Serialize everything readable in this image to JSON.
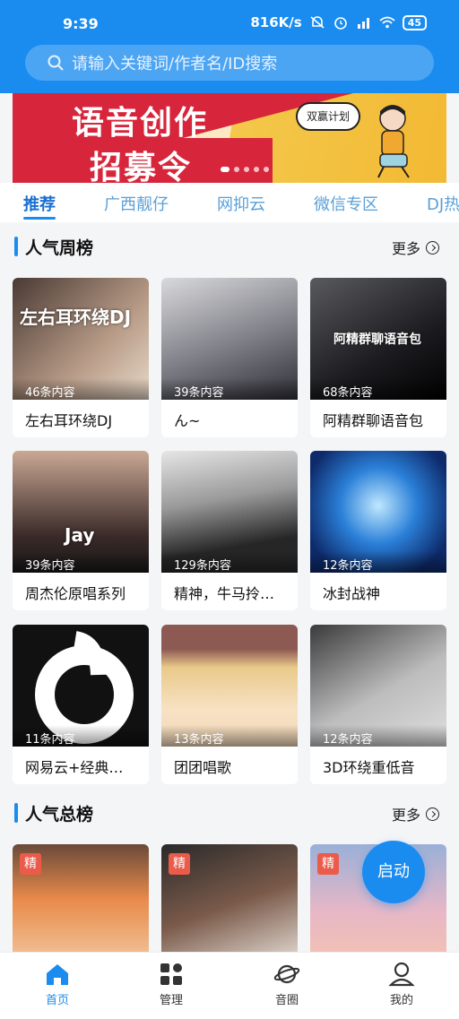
{
  "status_bar": {
    "time": "9:39",
    "speed": "816K/s",
    "battery": "45"
  },
  "search": {
    "placeholder": "请输入关键词/作者名/ID搜索"
  },
  "banner": {
    "line1": "语音创作",
    "line2": "招募令",
    "bubble": "双赢计划"
  },
  "tabs": [
    "推荐",
    "广西靓仔",
    "网抑云",
    "微信专区",
    "DJ热"
  ],
  "weekly": {
    "title": "人气周榜",
    "more": "更多",
    "cards": [
      {
        "title": "左右耳环绕DJ",
        "count": "46条内容",
        "cover_text": "左右耳环绕DJ"
      },
      {
        "title": "ん~",
        "count": "39条内容"
      },
      {
        "title": "阿精群聊语音包",
        "count": "68条内容",
        "cover_text": "阿精群聊语音包"
      },
      {
        "title": "周杰伦原唱系列",
        "count": "39条内容",
        "cover_text": "Jay"
      },
      {
        "title": "精神，牛马拎…",
        "count": "129条内容"
      },
      {
        "title": "冰封战神",
        "count": "12条内容"
      },
      {
        "title": "网易云+经典…",
        "count": "11条内容"
      },
      {
        "title": "团团唱歌",
        "count": "13条内容"
      },
      {
        "title": "3D环绕重低音",
        "count": "12条内容"
      }
    ]
  },
  "total": {
    "title": "人气总榜",
    "more": "更多",
    "cards": [
      {
        "tag": "精"
      },
      {
        "tag": "精"
      },
      {
        "tag": "精"
      }
    ]
  },
  "launch_button": "启动",
  "nav": [
    {
      "label": "首页",
      "icon": "home-icon"
    },
    {
      "label": "管理",
      "icon": "grid-icon"
    },
    {
      "label": "音圈",
      "icon": "planet-icon"
    },
    {
      "label": "我的",
      "icon": "user-icon"
    }
  ],
  "colors": {
    "primary": "#1a8cf0",
    "tag": "#ea5b4a"
  }
}
